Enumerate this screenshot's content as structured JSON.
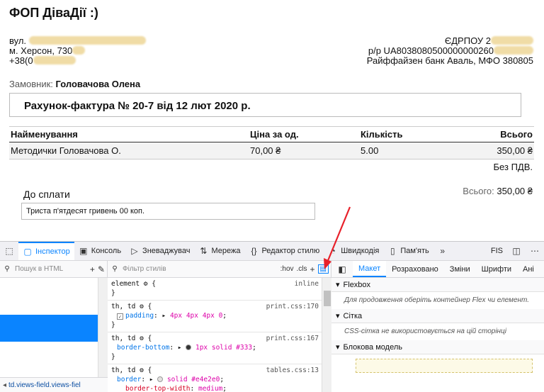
{
  "invoice": {
    "company": "ФОП ДіваДії :)",
    "address": [
      "вул.",
      "м. Херсон, 730",
      "+38(0"
    ],
    "bank": [
      "ЄДРПОУ 2",
      "р/р UA8038080500000000260",
      "Райффайзен банк Аваль, МФО 380805"
    ],
    "customer_label": "Замовник:",
    "customer_name": "Головачова Олена",
    "title": "Рахунок-фактура № 20-7 від 12 лют 2020 р.",
    "table": {
      "headers": [
        "Найменування",
        "Ціна за од.",
        "Кількість",
        "Всього"
      ],
      "rows": [
        [
          "Методички Головачова О.",
          "70,00 ₴",
          "5.00",
          "350,00 ₴"
        ]
      ]
    },
    "vat_note": "Без ПДВ.",
    "total_label": "Всього:",
    "total_value": "350,00 ₴",
    "pay_label": "До сплати",
    "pay_words": "Триста п'ятдесят гривень 00 коп.",
    "redaction_color": "#f0dca6"
  },
  "devtools": {
    "tabs": [
      {
        "label": "Інспектор",
        "icon": "inspector-icon"
      },
      {
        "label": "Консоль",
        "icon": "console-icon"
      },
      {
        "label": "Зневаджувач",
        "icon": "debugger-icon"
      },
      {
        "label": "Мережа",
        "icon": "network-icon"
      },
      {
        "label": "Редактор стилю",
        "icon": "style-editor-icon"
      },
      {
        "label": "Швидкодія",
        "icon": "performance-icon"
      },
      {
        "label": "Пам'ять",
        "icon": "memory-icon"
      }
    ],
    "extra_label": "FIS",
    "html_search_placeholder": "Пошук в HTML",
    "style_filter_placeholder": "Фільтр стилів",
    "hov_label": ":hov",
    "cls_label": ".cls",
    "breadcrumb": "td.views-field.views-fiel",
    "rules": [
      {
        "selector": "element",
        "source": "inline",
        "decls": []
      },
      {
        "selector": "th, td",
        "source": "print.css:170",
        "decls": [
          {
            "prop": "padding",
            "value": "4px 4px 4px 0",
            "checked": true
          }
        ]
      },
      {
        "selector": "th, td",
        "source": "print.css:167",
        "decls": [
          {
            "prop": "border-bottom",
            "value": "1px solid #333",
            "swatch": "#333333"
          }
        ]
      },
      {
        "selector": "th, td",
        "source": "tables.css:13",
        "decls": [
          {
            "prop": "border",
            "value": "solid #e4e2e0",
            "swatch": "#e4e2e0"
          },
          {
            "prop": "border-top-width",
            "value": "medium"
          }
        ]
      }
    ],
    "layout_tabs": [
      "Макет",
      "Розраховано",
      "Зміни",
      "Шрифти",
      "Ані"
    ],
    "flexbox_title": "Flexbox",
    "flexbox_hint": "Для продовження оберіть контейнер Flex чи елемент.",
    "grid_title": "Сітка",
    "grid_hint": "CSS-сітка не використовується на цій сторінці",
    "boxmodel_title": "Блокова модель",
    "accent_color": "#0a84ff"
  }
}
